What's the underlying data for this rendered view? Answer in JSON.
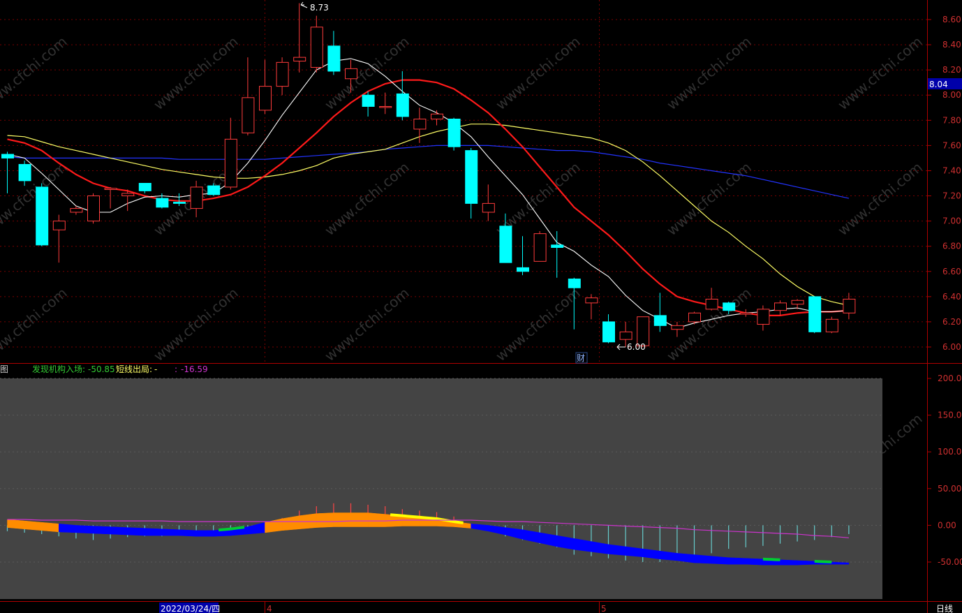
{
  "colors": {
    "background": "#000000",
    "grid": "#7a0000",
    "axis": "#b00000",
    "axis_text": "#d03030",
    "candle_up": "#ff3b3b",
    "candle_down": "#00ffff",
    "ma5": "#ffffff",
    "ma10": "#ff1a1a",
    "ma20": "#ffff66",
    "ma60": "#2233ff",
    "panel_bg": "#444444",
    "ind_main_neg": "#0000ff",
    "ind_main_pos": "#ff8c00",
    "ind_peak": "#ffff00",
    "ind_signal": "#00cc33",
    "ind_line": "#cc33cc",
    "ind_sticks": "#66cccc",
    "price_tag_bg": "#0000aa",
    "watermark": "#5a5a5a"
  },
  "watermark": "www.cfchi.com",
  "indicator_header": {
    "name": "图",
    "entry_label": "发现机构入场:",
    "entry_value": "-50.85",
    "short_label": "短线出局:",
    "short_value": "-",
    "third_label": ":",
    "third_value": "-16.59"
  },
  "price_tag": "8.04",
  "cwh_badge": "财",
  "bottom_axis": {
    "date_label": "2022/03/24/四",
    "month_4": "4",
    "month_5": "5",
    "period": "日线"
  },
  "chart_data": [
    {
      "type": "candlestick",
      "ylim": [
        5.88,
        8.68
      ],
      "yticks": [
        "8.60",
        "8.40",
        "8.20",
        "8.00",
        "7.80",
        "7.60",
        "7.40",
        "7.20",
        "7.00",
        "6.80",
        "6.60",
        "6.40",
        "6.20",
        "6.00"
      ],
      "annotations": {
        "high_label": "8.73",
        "low_label": "6.00"
      },
      "candles": [
        {
          "o": 7.53,
          "h": 7.55,
          "l": 7.22,
          "c": 7.5
        },
        {
          "o": 7.45,
          "h": 7.48,
          "l": 7.28,
          "c": 7.32
        },
        {
          "o": 7.27,
          "h": 7.3,
          "l": 6.8,
          "c": 6.81
        },
        {
          "o": 6.93,
          "h": 7.05,
          "l": 6.67,
          "c": 7.0
        },
        {
          "o": 7.07,
          "h": 7.12,
          "l": 7.05,
          "c": 7.1
        },
        {
          "o": 7.0,
          "h": 7.22,
          "l": 6.98,
          "c": 7.2
        },
        {
          "o": 7.25,
          "h": 7.27,
          "l": 7.1,
          "c": 7.26
        },
        {
          "o": 7.2,
          "h": 7.25,
          "l": 7.08,
          "c": 7.22
        },
        {
          "o": 7.3,
          "h": 7.3,
          "l": 7.22,
          "c": 7.24
        },
        {
          "o": 7.18,
          "h": 7.22,
          "l": 7.1,
          "c": 7.11
        },
        {
          "o": 7.15,
          "h": 7.22,
          "l": 7.12,
          "c": 7.14
        },
        {
          "o": 7.1,
          "h": 7.32,
          "l": 7.03,
          "c": 7.27
        },
        {
          "o": 7.28,
          "h": 7.3,
          "l": 7.2,
          "c": 7.21
        },
        {
          "o": 7.27,
          "h": 7.82,
          "l": 7.25,
          "c": 7.65
        },
        {
          "o": 7.7,
          "h": 8.3,
          "l": 7.68,
          "c": 7.98
        },
        {
          "o": 7.88,
          "h": 8.28,
          "l": 7.85,
          "c": 8.07
        },
        {
          "o": 8.07,
          "h": 8.3,
          "l": 8.0,
          "c": 8.26
        },
        {
          "o": 8.27,
          "h": 8.73,
          "l": 8.18,
          "c": 8.3
        },
        {
          "o": 8.22,
          "h": 8.63,
          "l": 8.18,
          "c": 8.54
        },
        {
          "o": 8.39,
          "h": 8.51,
          "l": 8.16,
          "c": 8.19
        },
        {
          "o": 8.13,
          "h": 8.28,
          "l": 8.02,
          "c": 8.21
        },
        {
          "o": 8.0,
          "h": 8.03,
          "l": 7.83,
          "c": 7.91
        },
        {
          "o": 7.91,
          "h": 8.02,
          "l": 7.85,
          "c": 7.91
        },
        {
          "o": 8.01,
          "h": 8.19,
          "l": 7.8,
          "c": 7.83
        },
        {
          "o": 7.73,
          "h": 7.9,
          "l": 7.62,
          "c": 7.81
        },
        {
          "o": 7.81,
          "h": 7.88,
          "l": 7.76,
          "c": 7.85
        },
        {
          "o": 7.81,
          "h": 7.82,
          "l": 7.56,
          "c": 7.59
        },
        {
          "o": 7.56,
          "h": 7.58,
          "l": 7.02,
          "c": 7.14
        },
        {
          "o": 7.07,
          "h": 7.29,
          "l": 7.0,
          "c": 7.14
        },
        {
          "o": 6.96,
          "h": 7.06,
          "l": 6.67,
          "c": 6.67
        },
        {
          "o": 6.63,
          "h": 6.88,
          "l": 6.57,
          "c": 6.6
        },
        {
          "o": 6.68,
          "h": 6.92,
          "l": 6.68,
          "c": 6.9
        },
        {
          "o": 6.81,
          "h": 6.92,
          "l": 6.55,
          "c": 6.79
        },
        {
          "o": 6.54,
          "h": 6.55,
          "l": 6.14,
          "c": 6.47
        },
        {
          "o": 6.35,
          "h": 6.42,
          "l": 6.22,
          "c": 6.39
        },
        {
          "o": 6.2,
          "h": 6.26,
          "l": 6.03,
          "c": 6.04
        },
        {
          "o": 6.06,
          "h": 6.2,
          "l": 6.0,
          "c": 6.12
        },
        {
          "o": 6.01,
          "h": 6.23,
          "l": 6.0,
          "c": 6.24
        },
        {
          "o": 6.25,
          "h": 6.43,
          "l": 6.12,
          "c": 6.17
        },
        {
          "o": 6.14,
          "h": 6.2,
          "l": 6.08,
          "c": 6.17
        },
        {
          "o": 6.2,
          "h": 6.28,
          "l": 6.18,
          "c": 6.27
        },
        {
          "o": 6.3,
          "h": 6.47,
          "l": 6.29,
          "c": 6.38
        },
        {
          "o": 6.35,
          "h": 6.36,
          "l": 6.26,
          "c": 6.29
        },
        {
          "o": 6.26,
          "h": 6.3,
          "l": 6.24,
          "c": 6.27
        },
        {
          "o": 6.18,
          "h": 6.33,
          "l": 6.13,
          "c": 6.3
        },
        {
          "o": 6.29,
          "h": 6.37,
          "l": 6.25,
          "c": 6.35
        },
        {
          "o": 6.34,
          "h": 6.38,
          "l": 6.3,
          "c": 6.37
        },
        {
          "o": 6.4,
          "h": 6.4,
          "l": 6.11,
          "c": 6.12
        },
        {
          "o": 6.12,
          "h": 6.24,
          "l": 6.11,
          "c": 6.22
        },
        {
          "o": 6.27,
          "h": 6.43,
          "l": 6.22,
          "c": 6.38
        }
      ],
      "series": [
        {
          "key": "ma5",
          "values": [
            7.53,
            7.5,
            7.38,
            7.25,
            7.12,
            7.07,
            7.07,
            7.14,
            7.19,
            7.2,
            7.19,
            7.21,
            7.22,
            7.31,
            7.46,
            7.64,
            7.84,
            8.02,
            8.2,
            8.27,
            8.29,
            8.25,
            8.15,
            8.03,
            7.92,
            7.86,
            7.78,
            7.67,
            7.51,
            7.36,
            7.21,
            7.02,
            6.83,
            6.76,
            6.65,
            6.56,
            6.41,
            6.29,
            6.22,
            6.15,
            6.19,
            6.22,
            6.25,
            6.27,
            6.28,
            6.3,
            6.31,
            6.28,
            6.28,
            6.29
          ]
        },
        {
          "key": "ma10",
          "values": [
            7.65,
            7.62,
            7.56,
            7.46,
            7.37,
            7.3,
            7.26,
            7.24,
            7.2,
            7.17,
            7.16,
            7.16,
            7.18,
            7.21,
            7.27,
            7.36,
            7.46,
            7.58,
            7.7,
            7.83,
            7.94,
            8.03,
            8.09,
            8.12,
            8.12,
            8.1,
            8.05,
            7.96,
            7.86,
            7.73,
            7.59,
            7.43,
            7.27,
            7.11,
            7.0,
            6.89,
            6.76,
            6.62,
            6.5,
            6.4,
            6.36,
            6.33,
            6.3,
            6.27,
            6.25,
            6.25,
            6.27,
            6.28,
            6.28,
            6.29
          ]
        },
        {
          "key": "ma20",
          "values": [
            7.68,
            7.67,
            7.63,
            7.59,
            7.56,
            7.53,
            7.5,
            7.47,
            7.44,
            7.41,
            7.39,
            7.37,
            7.35,
            7.34,
            7.34,
            7.35,
            7.37,
            7.4,
            7.44,
            7.5,
            7.53,
            7.55,
            7.57,
            7.62,
            7.67,
            7.71,
            7.74,
            7.77,
            7.77,
            7.76,
            7.74,
            7.72,
            7.7,
            7.68,
            7.66,
            7.62,
            7.56,
            7.47,
            7.36,
            7.24,
            7.12,
            7.0,
            6.91,
            6.8,
            6.7,
            6.58,
            6.48,
            6.4,
            6.36,
            6.33
          ]
        },
        {
          "key": "ma60",
          "values": [
            7.51,
            7.5,
            7.5,
            7.5,
            7.5,
            7.5,
            7.5,
            7.5,
            7.5,
            7.5,
            7.49,
            7.49,
            7.49,
            7.49,
            7.49,
            7.49,
            7.5,
            7.51,
            7.52,
            7.53,
            7.54,
            7.55,
            7.57,
            7.58,
            7.59,
            7.6,
            7.6,
            7.6,
            7.6,
            7.59,
            7.58,
            7.57,
            7.56,
            7.56,
            7.55,
            7.53,
            7.51,
            7.49,
            7.46,
            7.44,
            7.42,
            7.4,
            7.38,
            7.36,
            7.33,
            7.3,
            7.27,
            7.24,
            7.21,
            7.18
          ]
        }
      ]
    },
    {
      "type": "area",
      "ylim": [
        -103,
        205
      ],
      "yticks": [
        "200.00",
        "150.00",
        "100.00",
        "50.00",
        "0.00",
        "-50.00"
      ],
      "series": [
        {
          "key": "lower",
          "values": [
            -3,
            -5,
            -7,
            -9,
            -10,
            -11,
            -12,
            -13,
            -14,
            -14,
            -14,
            -15,
            -15,
            -14,
            -12,
            -10,
            -7,
            -5,
            -3,
            -2,
            -2,
            -2,
            -2,
            -1,
            -1,
            -1,
            -2,
            -4,
            -8,
            -13,
            -19,
            -24,
            -29,
            -33,
            -36,
            -39,
            -41,
            -43,
            -46,
            -48,
            -51,
            -52,
            -53,
            -53,
            -54,
            -54,
            -54,
            -53,
            -53,
            -53
          ]
        },
        {
          "key": "upper",
          "values": [
            8,
            6,
            4,
            2,
            0,
            -1,
            -2,
            -3,
            -4,
            -5,
            -6,
            -7,
            -7,
            -5,
            -2,
            4,
            9,
            13,
            16,
            17,
            17,
            17,
            15,
            13,
            11,
            9,
            5,
            2,
            0,
            -3,
            -6,
            -10,
            -14,
            -18,
            -22,
            -26,
            -29,
            -32,
            -35,
            -38,
            -40,
            -42,
            -44,
            -45,
            -46,
            -47,
            -48,
            -49,
            -50,
            -51
          ]
        },
        {
          "key": "line",
          "values": [
            8,
            8,
            7,
            7,
            7,
            6,
            6,
            6,
            6,
            6,
            5,
            5,
            5,
            5,
            5,
            5,
            5,
            5,
            5,
            5,
            6,
            6,
            6,
            7,
            7,
            7,
            7,
            7,
            6,
            5,
            5,
            4,
            3,
            2,
            1,
            0,
            -1,
            -2,
            -3,
            -4,
            -6,
            -7,
            -8,
            -9,
            -10,
            -11,
            -12,
            -14,
            -15,
            -17
          ]
        },
        {
          "key": "sticks",
          "values": [
            -8,
            -10,
            -12,
            -15,
            -18,
            -20,
            -18,
            -16,
            -15,
            -15,
            -12,
            -12,
            -10,
            -8,
            -5,
            5,
            10,
            20,
            26,
            30,
            30,
            28,
            26,
            22,
            20,
            18,
            12,
            -3,
            -8,
            -15,
            -20,
            -25,
            -30,
            -40,
            -42,
            -45,
            -48,
            -50,
            -50,
            -45,
            -40,
            -38,
            -32,
            -30,
            -28,
            -25,
            -22,
            -20,
            -16,
            -12
          ]
        }
      ],
      "signals": [
        {
          "from": 12.3,
          "to": 13.8,
          "color": "signal"
        },
        {
          "from": 22.3,
          "to": 26.6,
          "color": "peak"
        },
        {
          "from": 44.0,
          "to": 45.0,
          "color": "signal"
        },
        {
          "from": 47.0,
          "to": 48.0,
          "color": "signal"
        }
      ]
    }
  ]
}
